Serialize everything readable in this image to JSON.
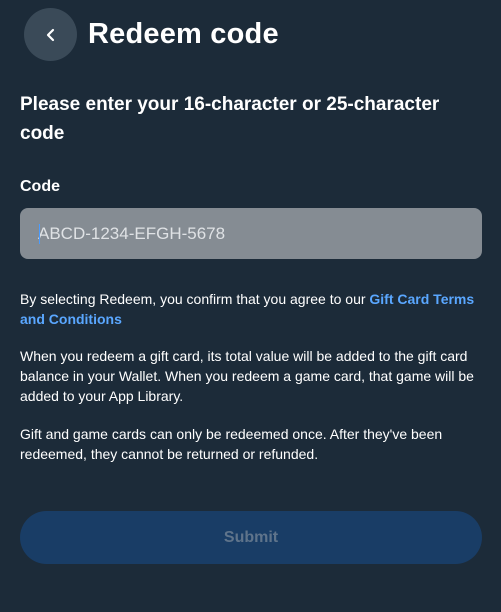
{
  "header": {
    "title": "Redeem code",
    "back_icon": "chevron-left-icon"
  },
  "form": {
    "instruction": "Please enter your 16-character or 25-character code",
    "code_label": "Code",
    "code_placeholder": "ABCD-1234-EFGH-5678",
    "code_value": ""
  },
  "info": {
    "p1_prefix": "By selecting Redeem, you confirm that you agree to our ",
    "p1_link": "Gift Card Terms and Conditions",
    "p2": "When you redeem a gift card, its total value will be added to the gift card balance in your Wallet. When you redeem a game card, that game will be added to your App Library.",
    "p3": "Gift and game cards can only be redeemed once. After they've been redeemed, they cannot be returned or refunded."
  },
  "actions": {
    "submit_label": "Submit",
    "submit_enabled": false
  },
  "colors": {
    "background": "#1c2b39",
    "link": "#5aa7ff",
    "button_disabled_bg": "#193d66",
    "button_disabled_text": "#5f748b",
    "input_bg": "#858c93"
  }
}
